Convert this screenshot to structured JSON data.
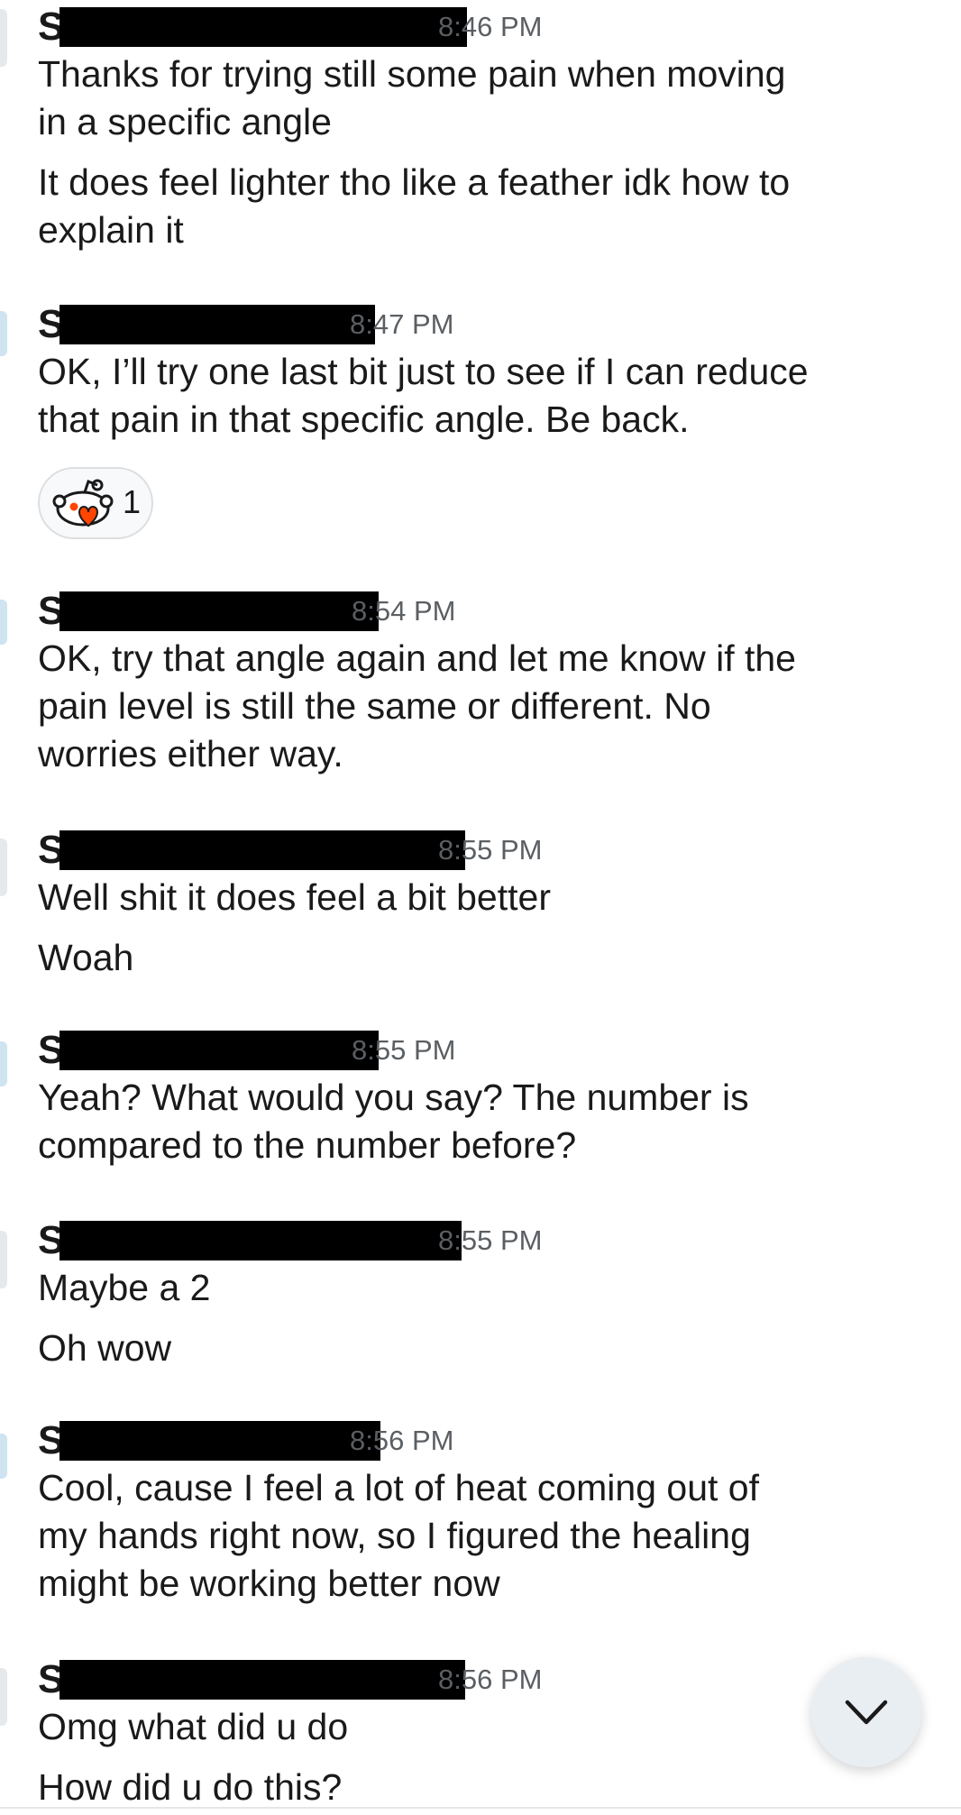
{
  "messages": [
    {
      "sender_initial": "S",
      "time": "8:46 PM",
      "lines": [
        "Thanks for trying still some pain when moving",
        "in a specific angle",
        "",
        "It does feel lighter tho like a feather idk how to",
        "explain it"
      ]
    },
    {
      "sender_initial": "S",
      "time": "8:47 PM",
      "lines": [
        "OK, I’ll try one last bit just to see if I can reduce",
        "that pain in that specific angle. Be back."
      ]
    },
    {
      "sender_initial": "S",
      "time": "8:54 PM",
      "lines": [
        "OK, try that angle again and let me know if the",
        "pain level is still the same or different. No",
        "worries either way."
      ]
    },
    {
      "sender_initial": "S",
      "time": "8:55 PM",
      "lines": [
        "Well shit it does feel a bit better",
        "",
        "Woah"
      ]
    },
    {
      "sender_initial": "S",
      "time": "8:55 PM",
      "lines": [
        "Yeah? What would you say? The number is",
        "compared to the number before?"
      ]
    },
    {
      "sender_initial": "S",
      "time": "8:55 PM",
      "lines": [
        "Maybe a 2",
        "",
        "Oh wow"
      ]
    },
    {
      "sender_initial": "S",
      "time": "8:56 PM",
      "lines": [
        "Cool, cause I feel a lot of heat coming out of",
        "my hands right now, so I figured the healing",
        "might be working better now"
      ]
    },
    {
      "sender_initial": "S",
      "time": "8:56 PM",
      "lines": [
        "Omg what did u do",
        "",
        "How did u do this?"
      ]
    }
  ],
  "reaction": {
    "icon": "snoo-heart-icon",
    "count": "1"
  },
  "scroll_button": {
    "icon": "chevron-down-icon"
  },
  "colors": {
    "text": "#1a1a1b",
    "timestamp": "#5b5f63",
    "redaction": "#000000",
    "fab_bg": "#e9eef3"
  }
}
